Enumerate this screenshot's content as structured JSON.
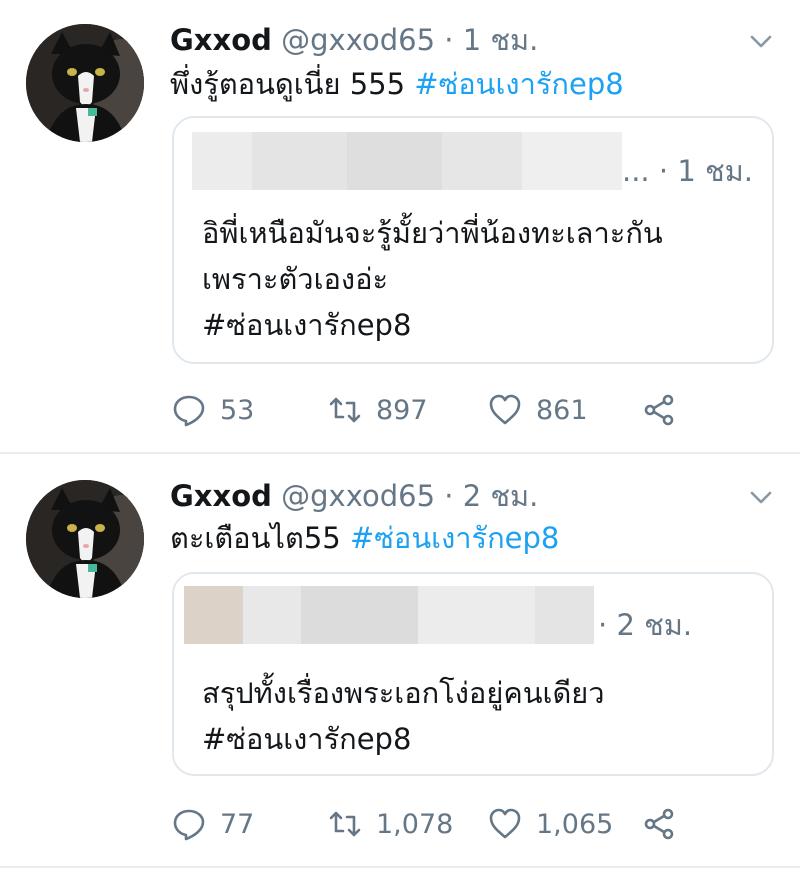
{
  "tweets": [
    {
      "name": "Gxxod",
      "handle": "@gxxod65",
      "separator": "·",
      "time": "1 ชม.",
      "text": "พึ่งรู้ตอนดูเนี่ย 555",
      "hashtag": "#ซ่อนเงารักep8",
      "quote": {
        "meta_ellipsis": "...",
        "separator": "·",
        "time": "1 ชม.",
        "lines": [
          "อิพี่เหนือมันจะรู้มั้ยว่าพี่น้องทะเลาะกัน",
          "เพราะตัวเองอ่ะ",
          "#ซ่อนเงารักep8"
        ]
      },
      "replies": "53",
      "retweets": "897",
      "likes": "861"
    },
    {
      "name": "Gxxod",
      "handle": "@gxxod65",
      "separator": "·",
      "time": "2 ชม.",
      "text": "ตะเตือนไต55",
      "hashtag": "#ซ่อนเงารักep8",
      "quote": {
        "separator": "·",
        "time": "2 ชม.",
        "lines": [
          "สรุปทั้งเรื่องพระเอกโง่อยู่คนเดียว",
          "#ซ่อนเงารักep8"
        ]
      },
      "replies": "77",
      "retweets": "1,078",
      "likes": "1,065"
    }
  ],
  "icons": [
    "reply-icon",
    "retweet-icon",
    "like-icon",
    "share-icon",
    "chevron-down-icon"
  ],
  "colors": {
    "link": "#1da1f2",
    "muted": "#657786",
    "border": "#e1e8ed"
  }
}
